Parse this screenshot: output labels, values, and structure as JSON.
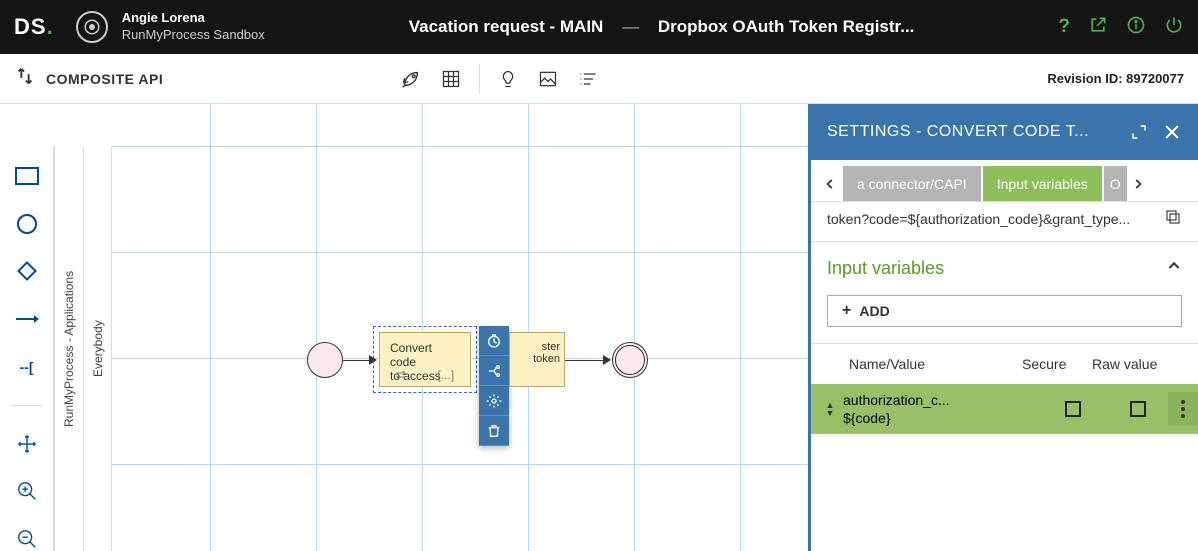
{
  "brand": {
    "ds": "DS",
    "dot": "."
  },
  "user": {
    "name": "Angie Lorena",
    "sandbox": "RunMyProcess Sandbox"
  },
  "breadcrumb": {
    "left": "Vacation request - MAIN",
    "sep": "—",
    "right": "Dropbox OAuth Token Registr..."
  },
  "secondbar": {
    "capi": "COMPOSITE API",
    "revision_label": "Revision ID: ",
    "revision_id": "89720077"
  },
  "vtabs": {
    "apps": "RunMyProcess - Applications",
    "everybody": "Everybody"
  },
  "nodes": {
    "task1_line1": "Convert code",
    "task1_line2": "to access",
    "task2": "ster token"
  },
  "settings": {
    "title": "SETTINGS  -  CONVERT CODE T...",
    "tabs": {
      "prev": "a connector/CAPI",
      "active": "Input variables",
      "next": "O"
    },
    "url": "token?code=${authorization_code}&grant_type...",
    "section": "Input variables",
    "add": "ADD",
    "cols": {
      "name": "Name/Value",
      "secure": "Secure",
      "raw": "Raw value"
    },
    "row1": {
      "name": "authorization_c...",
      "value": "${code}"
    }
  }
}
